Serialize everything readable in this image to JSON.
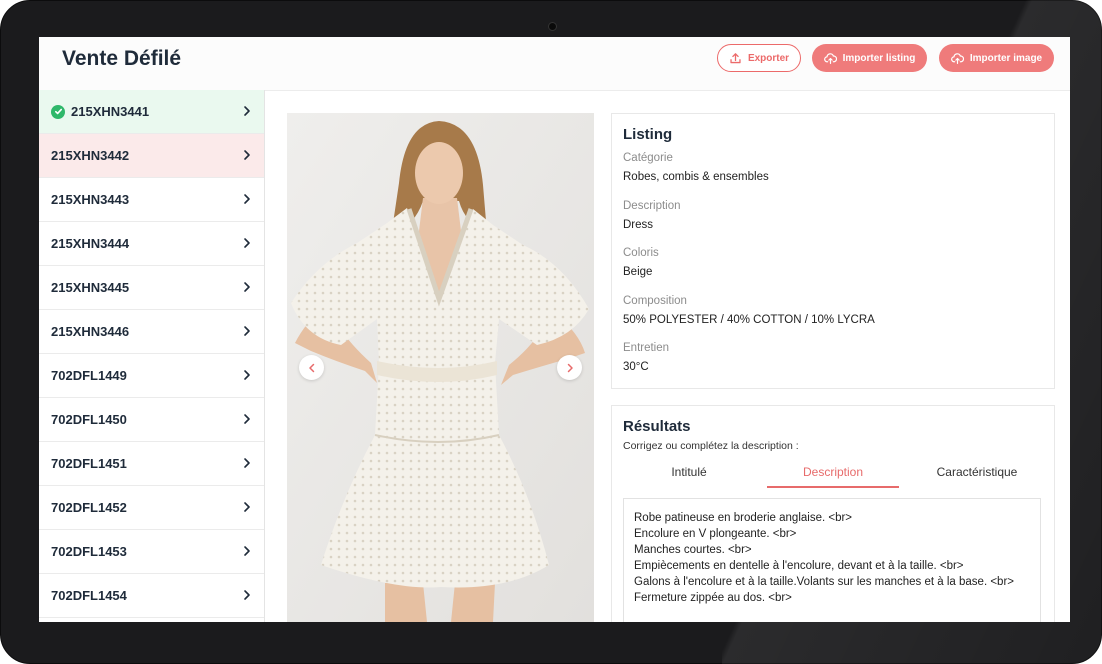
{
  "app": {
    "title": "Vente Défilé"
  },
  "header": {
    "export_label": "Exporter",
    "import_listing_label": "Importer listing",
    "import_image_label": "Importer image"
  },
  "sidebar": {
    "items": [
      {
        "code": "215XHN3441",
        "state": "validated"
      },
      {
        "code": "215XHN3442",
        "state": "selected"
      },
      {
        "code": "215XHN3443",
        "state": "default"
      },
      {
        "code": "215XHN3444",
        "state": "default"
      },
      {
        "code": "215XHN3445",
        "state": "default"
      },
      {
        "code": "215XHN3446",
        "state": "default"
      },
      {
        "code": "702DFL1449",
        "state": "default"
      },
      {
        "code": "702DFL1450",
        "state": "default"
      },
      {
        "code": "702DFL1451",
        "state": "default"
      },
      {
        "code": "702DFL1452",
        "state": "default"
      },
      {
        "code": "702DFL1453",
        "state": "default"
      },
      {
        "code": "702DFL1454",
        "state": "default"
      }
    ]
  },
  "listing": {
    "title": "Listing",
    "fields": [
      {
        "label": "Catégorie",
        "value": "Robes, combis & ensembles"
      },
      {
        "label": "Description",
        "value": "Dress"
      },
      {
        "label": "Coloris",
        "value": "Beige"
      },
      {
        "label": "Composition",
        "value": "50% POLYESTER / 40% COTTON / 10% LYCRA"
      },
      {
        "label": "Entretien",
        "value": "30°C"
      }
    ]
  },
  "results": {
    "title": "Résultats",
    "hint": "Corrigez ou complétez la description :",
    "tabs": [
      {
        "label": "Intitulé",
        "active": false
      },
      {
        "label": "Description",
        "active": true
      },
      {
        "label": "Caractéristique",
        "active": false
      }
    ],
    "description_lines": [
      "Robe patineuse en broderie anglaise. <br>",
      "Encolure en V plongeante. <br>",
      "Manches courtes. <br>",
      "Empiècements en dentelle à l'encolure, devant et à la taille. <br>",
      "Galons à l'encolure et à la taille.Volants sur les manches et à la base. <br>",
      "Fermeture zippée au dos. <br>"
    ]
  },
  "icons": {
    "export": "upload-icon",
    "import": "cloud-upload-icon",
    "validated": "check-circle-icon",
    "row_arrow": "chevron-right-icon",
    "carousel_prev": "chevron-left-icon",
    "carousel_next": "chevron-right-icon"
  },
  "colors": {
    "accent": "#ef7b7b",
    "accent_text": "#e76b6b",
    "validated_bg": "#eaf9ef",
    "validated_icon": "#2fb86a",
    "selected_bg": "#fbeaea",
    "title_text": "#1f2b3a"
  }
}
